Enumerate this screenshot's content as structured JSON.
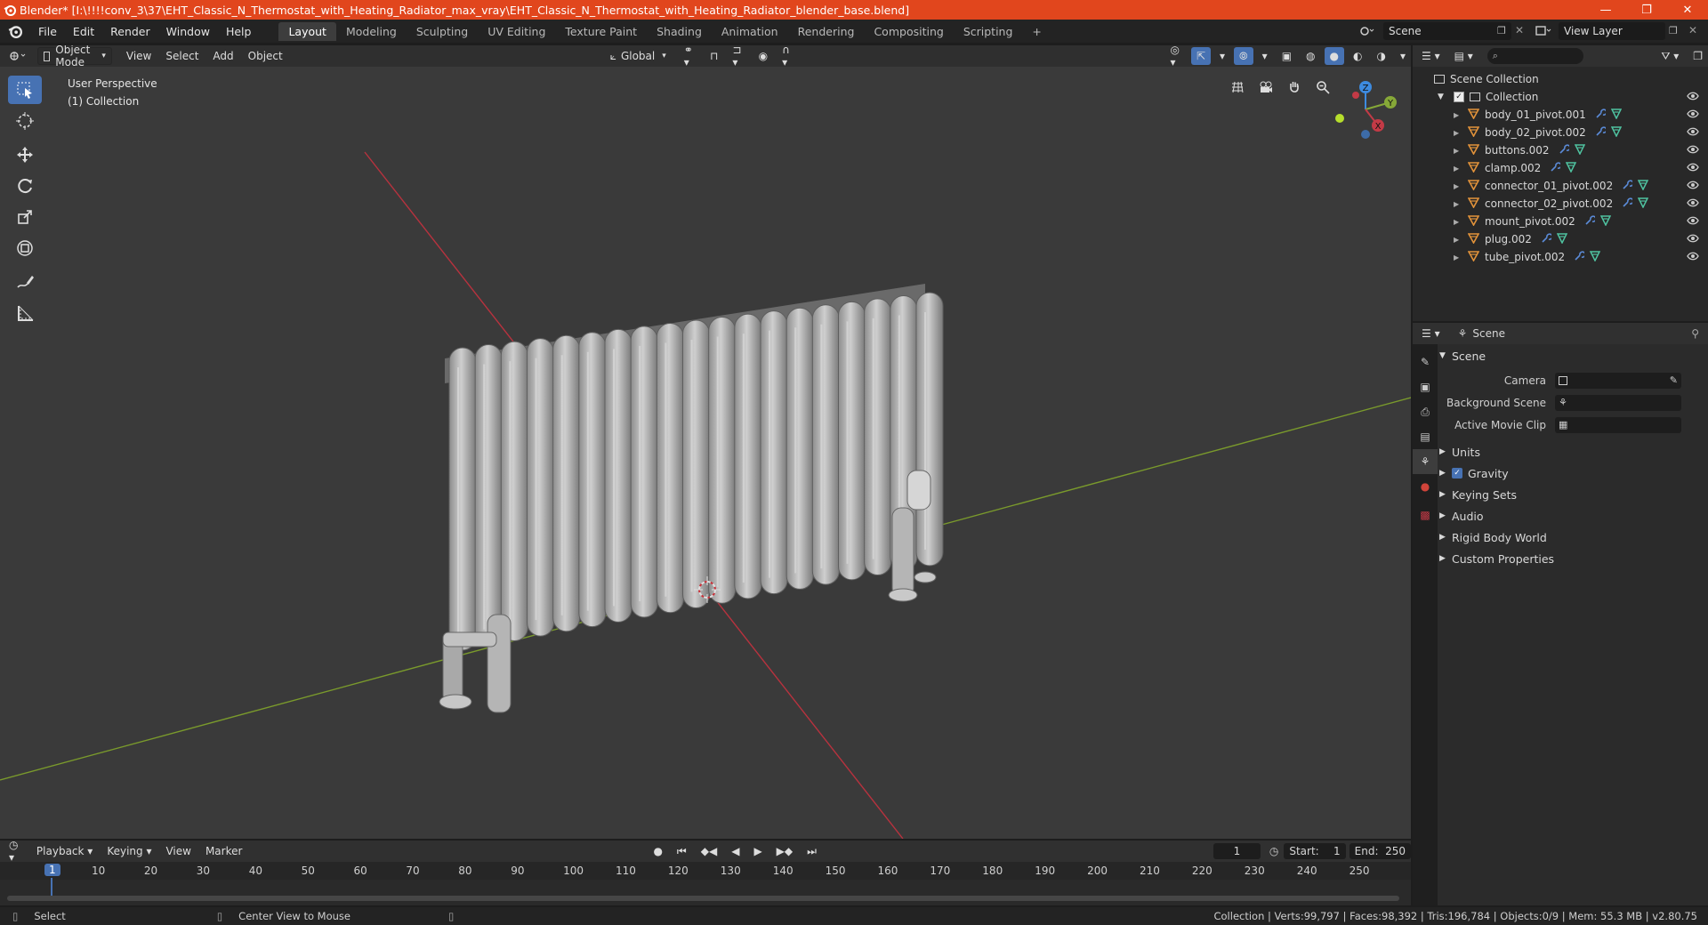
{
  "titlebar": {
    "title": "Blender* [I:\\!!!!conv_3\\37\\EHT_Classic_N_Thermostat_with_Heating_Radiator_max_vray\\EHT_Classic_N_Thermostat_with_Heating_Radiator_blender_base.blend]",
    "minimize": "—",
    "restore": "❐",
    "close": "✕"
  },
  "menu": [
    "File",
    "Edit",
    "Render",
    "Window",
    "Help"
  ],
  "workspaces": [
    "Layout",
    "Modeling",
    "Sculpting",
    "UV Editing",
    "Texture Paint",
    "Shading",
    "Animation",
    "Rendering",
    "Compositing",
    "Scripting"
  ],
  "active_workspace": "Layout",
  "add_workspace": "+",
  "scene_name": "Scene",
  "view_layer": "View Layer",
  "viewport": {
    "mode": "Object Mode",
    "menus": [
      "View",
      "Select",
      "Add",
      "Object"
    ],
    "orientation": "Global",
    "info_line1": "User Perspective",
    "info_line2": "(1) Collection",
    "gizmo": {
      "z": "Z",
      "y": "Y",
      "x": "X"
    }
  },
  "outliner": {
    "root": "Scene Collection",
    "collection": "Collection",
    "objects": [
      "body_01_pivot.001",
      "body_02_pivot.002",
      "buttons.002",
      "clamp.002",
      "connector_01_pivot.002",
      "connector_02_pivot.002",
      "mount_pivot.002",
      "plug.002",
      "tube_pivot.002"
    ]
  },
  "properties": {
    "header": "Scene",
    "section": "Scene",
    "camera_label": "Camera",
    "bg_scene_label": "Background Scene",
    "movie_clip_label": "Active Movie Clip",
    "subsections": [
      "Units",
      "Gravity",
      "Keying Sets",
      "Audio",
      "Rigid Body World",
      "Custom Properties"
    ],
    "gravity_checked": true
  },
  "timeline": {
    "menus": [
      "Playback",
      "Keying",
      "View",
      "Marker"
    ],
    "current_frame": "1",
    "start_label": "Start:",
    "start": "1",
    "end_label": "End:",
    "end": "250",
    "ticks": [
      "1",
      "10",
      "20",
      "30",
      "40",
      "50",
      "60",
      "70",
      "80",
      "90",
      "100",
      "110",
      "120",
      "130",
      "140",
      "150",
      "160",
      "170",
      "180",
      "190",
      "200",
      "210",
      "220",
      "230",
      "240",
      "250"
    ]
  },
  "status": {
    "select": "Select",
    "center_view": "Center View to Mouse",
    "stats": "Collection | Verts:99,797 | Faces:98,392 | Tris:196,784 | Objects:0/9 | Mem: 55.3 MB | v2.80.75"
  },
  "colors": {
    "titlebar": "#e1461d",
    "active_tool": "#4772b3",
    "x_axis": "#c33a46",
    "y_axis": "#86a838",
    "z_axis": "#3d8be0",
    "object_icon": "#e1923a",
    "modifier_icon": "#5b8bd8",
    "mesh_icon": "#4fc3a0"
  }
}
